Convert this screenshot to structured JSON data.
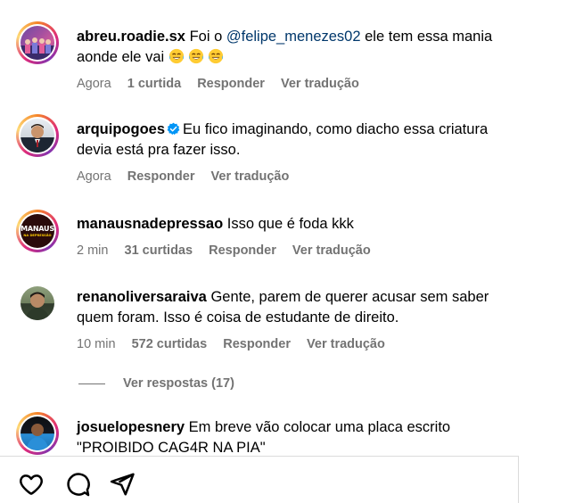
{
  "comments": [
    {
      "username": "abreu.roadie.sx",
      "text_before": "Foi o ",
      "mention": "@felipe_menezes02",
      "text_after": " ele tem essa mania aonde ele vai",
      "emojis": [
        "face-with-tears-of-joy",
        "face-with-tears-of-joy",
        "face-with-tears-of-joy"
      ],
      "time": "Agora",
      "likes": "1 curtida",
      "reply": "Responder",
      "translate": "Ver tradução",
      "avatar_ring": "story"
    },
    {
      "username": "arquipogoes",
      "verified": true,
      "text": "Eu fico imaginando, como diacho essa criatura devia está pra fazer isso.",
      "time": "Agora",
      "reply": "Responder",
      "translate": "Ver tradução",
      "avatar_ring": "story"
    },
    {
      "username": "manausnadepressao",
      "text": "Isso que é foda kkk",
      "time": "2 min",
      "likes": "31 curtidas",
      "reply": "Responder",
      "translate": "Ver tradução",
      "avatar_ring": "story",
      "avatar_logo_line1": "MANAUS",
      "avatar_logo_line2": "NA DEPRESSÃO"
    },
    {
      "username": "renanoliversaraiva",
      "text": "Gente, parem de querer acusar sem saber quem foram. Isso é coisa de estudante de direito.",
      "time": "10 min",
      "likes": "572 curtidas",
      "reply": "Responder",
      "translate": "Ver tradução",
      "avatar_ring": "none",
      "view_replies": "Ver respostas (17)"
    },
    {
      "username": "josuelopesnery",
      "text": "Em breve vão colocar uma placa escrito \"PROIBIDO CAG4R NA PIA\"",
      "avatar_ring": "story"
    }
  ],
  "actions": [
    {
      "icon": "heart-icon"
    },
    {
      "icon": "comment-icon"
    },
    {
      "icon": "share-icon"
    }
  ],
  "colors": {
    "meta_text": "#737373",
    "mention": "#00376b",
    "verified": "#0095f6",
    "divider": "#dbdbdb"
  }
}
